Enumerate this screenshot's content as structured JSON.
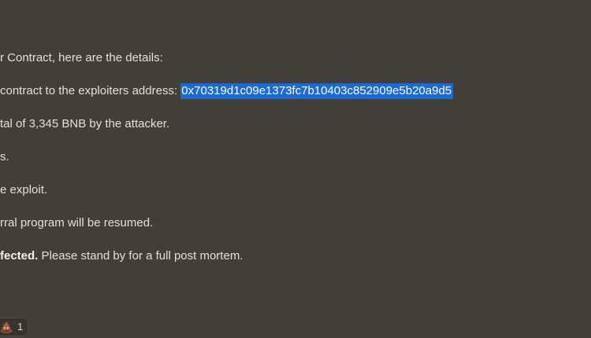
{
  "message": {
    "lines": [
      {
        "text": "r Contract, here are the details:"
      },
      {
        "prefix": "contract to the exploiters address: ",
        "highlight": "0x70319d1c09e1373fc7b10403c852909e5b20a9d5"
      },
      {
        "text": "tal of 3,345 BNB by the attacker."
      },
      {
        "text": "s."
      },
      {
        "text": "e exploit."
      },
      {
        "text": "rral program will be resumed."
      },
      {
        "bold": "fected.",
        "suffix": " Please stand by for a full post mortem."
      }
    ]
  },
  "reaction": {
    "emoji_icon": "poop-emoji-icon",
    "count": "1"
  },
  "colors": {
    "background": "#423e38",
    "text": "#e3e1dc",
    "selection": "#1a6bd6",
    "reaction_bg": "#37332f"
  }
}
